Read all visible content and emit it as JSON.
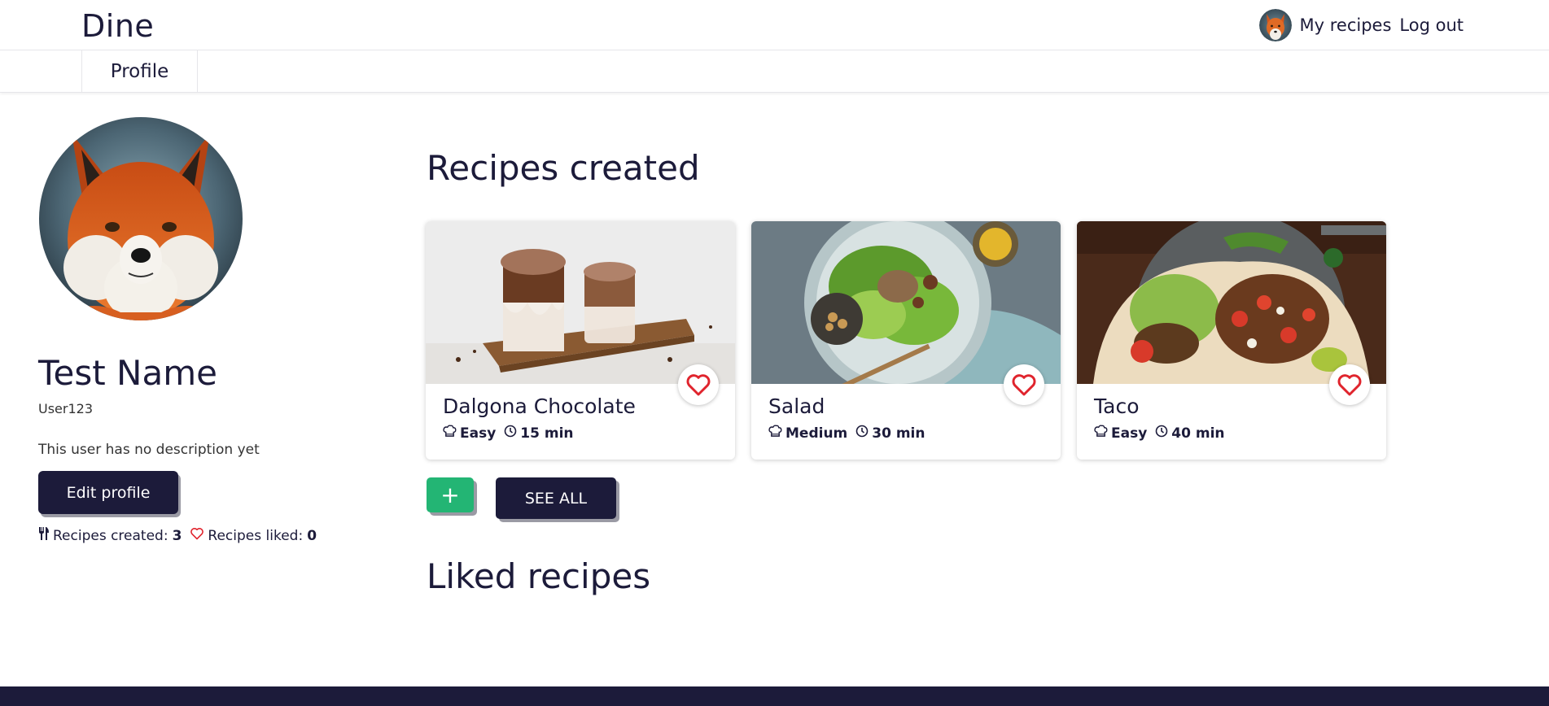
{
  "header": {
    "brand": "Dine",
    "nav": {
      "my_recipes": "My recipes",
      "log_out": "Log out"
    }
  },
  "tabs": [
    {
      "label": "Profile",
      "active": true
    }
  ],
  "profile": {
    "name": "Test Name",
    "username": "User123",
    "description": "This user has no description yet",
    "edit_label": "Edit profile",
    "stats": {
      "created_label": "Recipes created:",
      "created_count": "3",
      "liked_label": "Recipes liked:",
      "liked_count": "0"
    }
  },
  "sections": {
    "created_title": "Recipes created",
    "liked_title": "Liked recipes"
  },
  "recipes": [
    {
      "title": "Dalgona Chocolate",
      "difficulty": "Easy",
      "time": "15 min",
      "liked": false
    },
    {
      "title": "Salad",
      "difficulty": "Medium",
      "time": "30 min",
      "liked": false
    },
    {
      "title": "Taco",
      "difficulty": "Easy",
      "time": "40 min",
      "liked": false
    }
  ],
  "actions": {
    "add_label": "+",
    "see_all_label": "SEE ALL"
  },
  "colors": {
    "primary": "#1c1b3a",
    "accent_green": "#23b574",
    "heart_red": "#e0242d",
    "button_shadow": "#9a9aa4"
  },
  "icons": [
    "fox-avatar",
    "cutlery-icon",
    "heart-icon",
    "chef-hat-icon",
    "clock-icon",
    "plus-icon"
  ]
}
